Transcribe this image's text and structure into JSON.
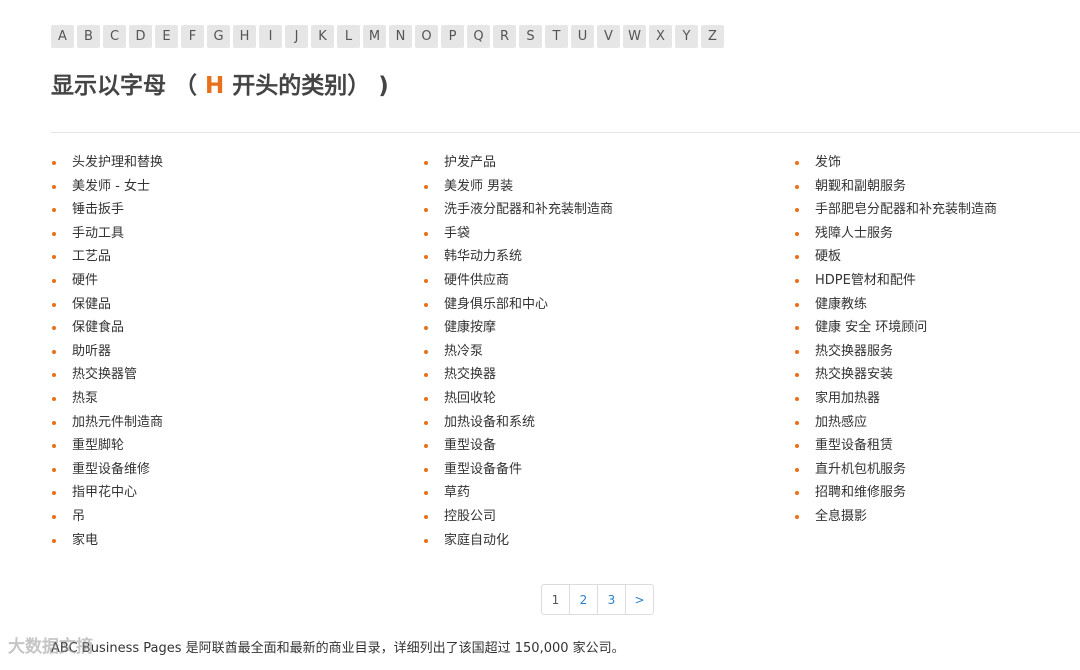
{
  "alphabet": [
    "A",
    "B",
    "C",
    "D",
    "E",
    "F",
    "G",
    "H",
    "I",
    "J",
    "K",
    "L",
    "M",
    "N",
    "O",
    "P",
    "Q",
    "R",
    "S",
    "T",
    "U",
    "V",
    "W",
    "X",
    "Y",
    "Z"
  ],
  "heading": {
    "prefix": "显示以字母 （",
    "letter": "H",
    "suffix": "开头的类别） )"
  },
  "columns": [
    [
      "头发护理和替换",
      "美发师 - 女士",
      "锤击扳手",
      "手动工具",
      "工艺品",
      "硬件",
      "保健品",
      "保健食品",
      "助听器",
      "热交换器管",
      "热泵",
      "加热元件制造商",
      "重型脚轮",
      "重型设备维修",
      "指甲花中心",
      "吊",
      "家电"
    ],
    [
      "护发产品",
      "美发师 男装",
      "洗手液分配器和补充装制造商",
      "手袋",
      "韩华动力系统",
      "硬件供应商",
      "健身俱乐部和中心",
      "健康按摩",
      "热冷泵",
      "热交换器",
      "热回收轮",
      "加热设备和系统",
      "重型设备",
      "重型设备备件",
      "草药",
      "控股公司",
      "家庭自动化"
    ],
    [
      "发饰",
      "朝觐和副朝服务",
      "手部肥皂分配器和补充装制造商",
      "残障人士服务",
      "硬板",
      "HDPE管材和配件",
      "健康教练",
      "健康 安全 环境顾问",
      "热交换器服务",
      "热交换器安装",
      "家用加热器",
      "加热感应",
      "重型设备租赁",
      "直升机包机服务",
      "招聘和维修服务",
      "全息摄影"
    ]
  ],
  "pagination": {
    "pages": [
      "1",
      "2",
      "3"
    ],
    "next": ">",
    "current": "1"
  },
  "footer": "ABC Business Pages 是阿联酋最全面和最新的商业目录，详细列出了该国超过 150,000 家公司。",
  "watermark": "大数据文摘",
  "colors": {
    "accent": "#e8701a",
    "link": "#2a80c8",
    "letter_bg": "#e6e6e6"
  }
}
